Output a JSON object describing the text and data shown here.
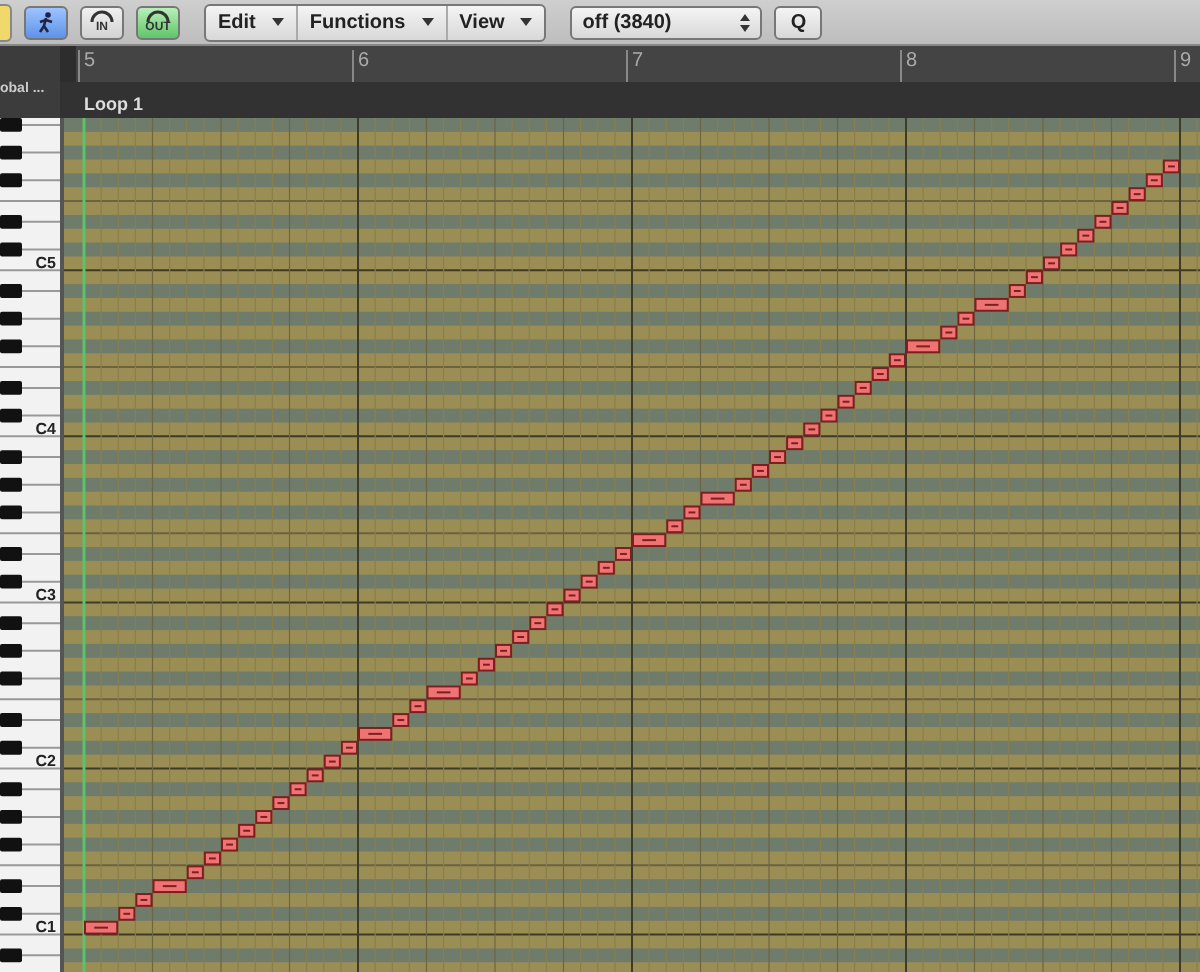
{
  "toolbar": {
    "catch_button": {
      "on": true
    },
    "midi_in": {
      "label": "IN",
      "on": false
    },
    "midi_out": {
      "label": "OUT",
      "on": true
    },
    "menus": [
      {
        "label": "Edit"
      },
      {
        "label": "Functions"
      },
      {
        "label": "View"
      }
    ],
    "quantize": {
      "value": "off (3840)"
    },
    "q_button": "Q"
  },
  "ruler": {
    "track_label": "obal ...",
    "bars": [
      "5",
      "6",
      "7",
      "8",
      "9"
    ],
    "region": "Loop 1"
  },
  "keyboard": {
    "labels": [
      "C5",
      "C4",
      "C3",
      "C2",
      "C1"
    ]
  }
}
